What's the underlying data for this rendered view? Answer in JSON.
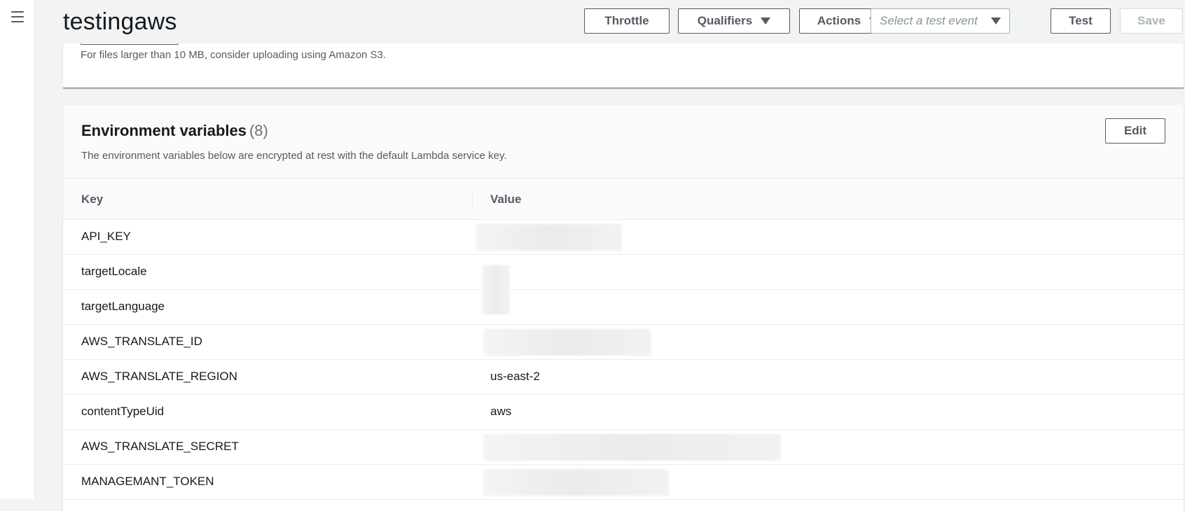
{
  "header": {
    "function_name": "testingaws",
    "throttle_label": "Throttle",
    "qualifiers_label": "Qualifiers",
    "actions_label": "Actions",
    "test_event_placeholder": "Select a test event",
    "test_label": "Test",
    "save_label": "Save"
  },
  "upload": {
    "hint": "For files larger than 10 MB, consider uploading using Amazon S3."
  },
  "env": {
    "title": "Environment variables",
    "count": "(8)",
    "description": "The environment variables below are encrypted at rest with the default Lambda service key.",
    "edit_label": "Edit",
    "columns": [
      "Key",
      "Value"
    ],
    "rows": [
      {
        "key": "API_KEY",
        "value": ""
      },
      {
        "key": "targetLocale",
        "value": ""
      },
      {
        "key": "targetLanguage",
        "value": ""
      },
      {
        "key": "AWS_TRANSLATE_ID",
        "value": ""
      },
      {
        "key": "AWS_TRANSLATE_REGION",
        "value": "us-east-2"
      },
      {
        "key": "contentTypeUid",
        "value": "aws"
      },
      {
        "key": "AWS_TRANSLATE_SECRET",
        "value": ""
      },
      {
        "key": "MANAGEMANT_TOKEN",
        "value": ""
      }
    ]
  },
  "colors": {
    "page_bg": "#f2f3f3",
    "panel_bg": "#ffffff",
    "button_border": "#545b64",
    "text_primary": "#16191f",
    "text_secondary": "#545b64"
  },
  "icons": {
    "menu": "hamburger-menu-icon",
    "dropdown": "caret-down-icon"
  }
}
